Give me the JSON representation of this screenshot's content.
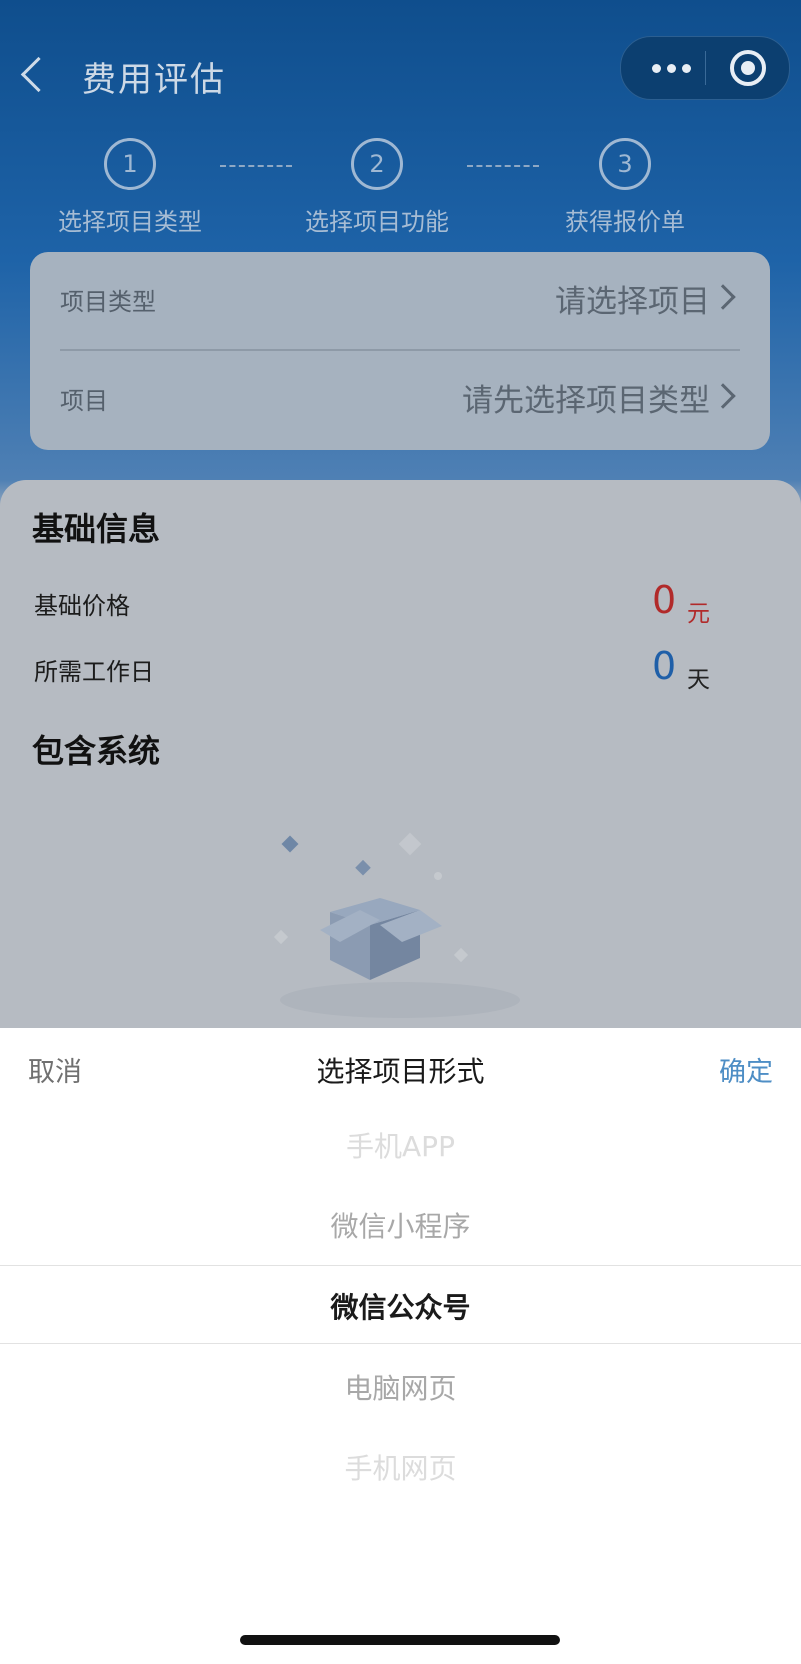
{
  "nav": {
    "title": "费用评估"
  },
  "steps": [
    {
      "num": "1",
      "label": "选择项目类型"
    },
    {
      "num": "2",
      "label": "选择项目功能"
    },
    {
      "num": "3",
      "label": "获得报价单"
    }
  ],
  "form": {
    "type_label": "项目类型",
    "type_value": "请选择项目",
    "project_label": "项目",
    "project_value": "请先选择项目类型"
  },
  "basic": {
    "title": "基础信息",
    "price_label": "基础价格",
    "price_value": "0",
    "price_unit": "元",
    "days_label": "所需工作日",
    "days_value": "0",
    "days_unit": "天",
    "system_title": "包含系统"
  },
  "picker": {
    "cancel": "取消",
    "title": "选择项目形式",
    "confirm": "确定",
    "options": [
      "手机APP",
      "微信小程序",
      "微信公众号",
      "电脑网页",
      "手机网页"
    ],
    "selected": "微信公众号"
  },
  "colors": {
    "price": "#b12a2a",
    "days": "#1f5fa8",
    "confirm": "#4e8ec5"
  }
}
